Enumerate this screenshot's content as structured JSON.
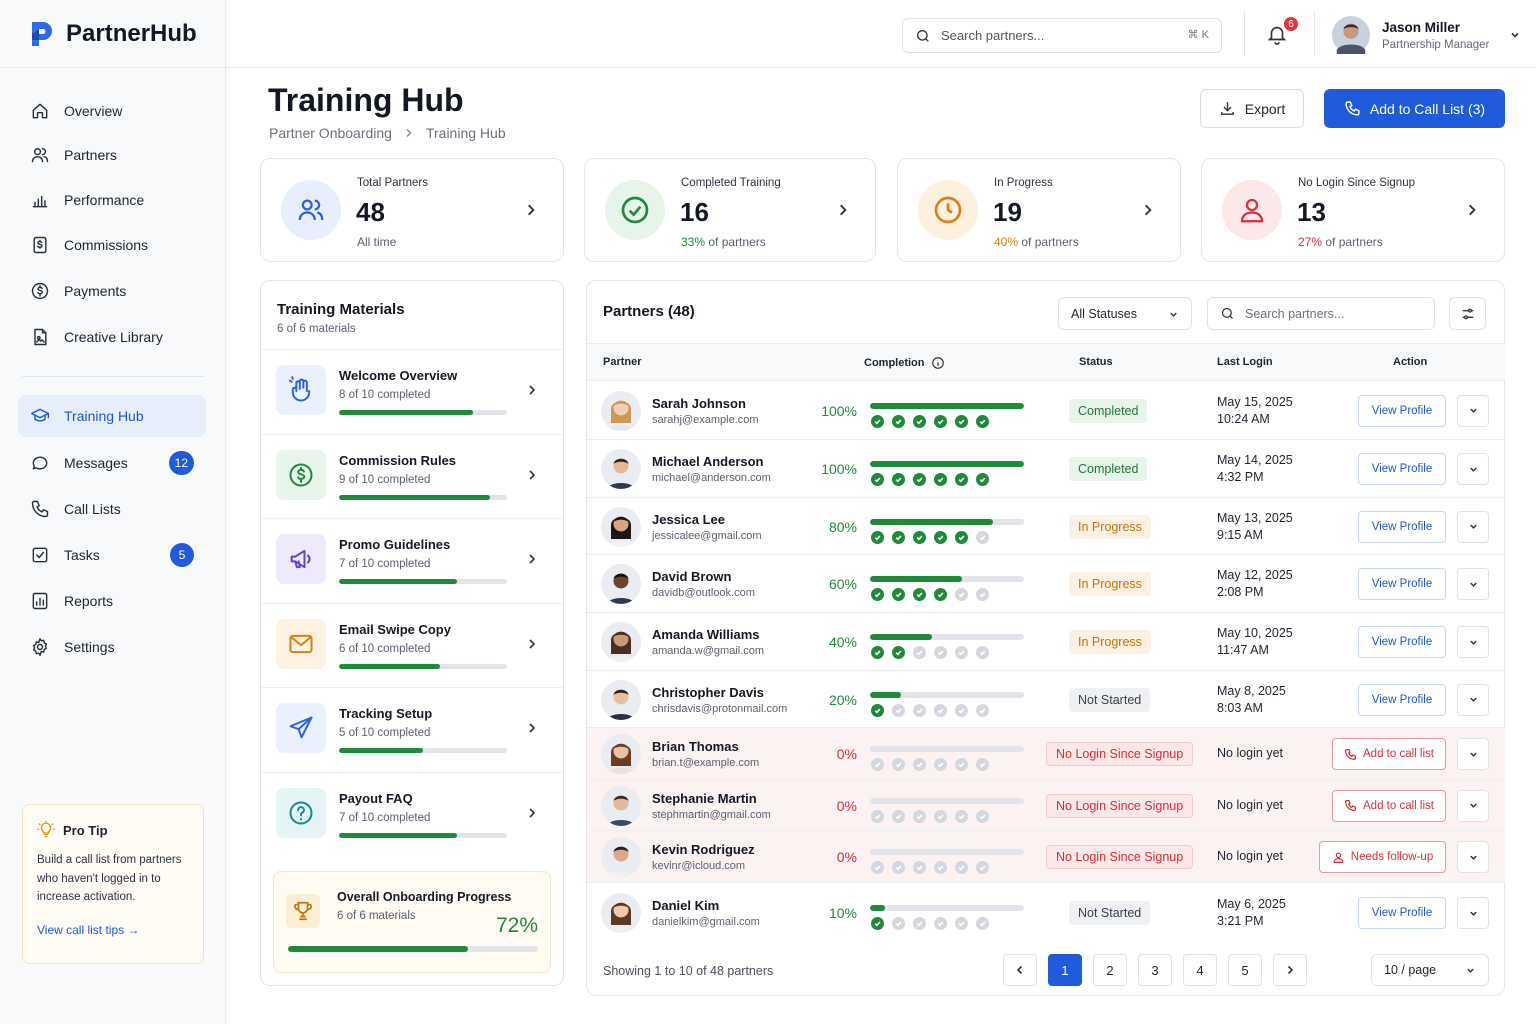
{
  "app": {
    "name": "PartnerHub"
  },
  "sidebar": {
    "items": [
      {
        "label": "Overview",
        "icon": "home-icon"
      },
      {
        "label": "Partners",
        "icon": "users-icon"
      },
      {
        "label": "Performance",
        "icon": "bar-chart-icon"
      },
      {
        "label": "Commissions",
        "icon": "dollar-doc-icon"
      },
      {
        "label": "Payments",
        "icon": "dollar-circle-icon"
      },
      {
        "label": "Creative Library",
        "icon": "image-file-icon"
      },
      {
        "label": "Training Hub",
        "icon": "graduation-cap-icon",
        "active": true
      },
      {
        "label": "Messages",
        "icon": "chat-icon",
        "badge": "12"
      },
      {
        "label": "Call Lists",
        "icon": "phone-icon"
      },
      {
        "label": "Tasks",
        "icon": "checkbox-icon",
        "badge": "5"
      },
      {
        "label": "Reports",
        "icon": "report-icon"
      },
      {
        "label": "Settings",
        "icon": "gear-icon"
      }
    ],
    "protip": {
      "title": "Pro Tip",
      "text": "Build a call list from partners who haven't logged in to increase activation.",
      "link": "View call list tips →"
    }
  },
  "topbar": {
    "search_placeholder": "Search partners...",
    "shortcut": "⌘ K",
    "notifications": "6",
    "user": {
      "name": "Jason Miller",
      "role": "Partnership Manager"
    }
  },
  "page": {
    "title": "Training Hub",
    "breadcrumbs": [
      "Partner Onboarding",
      "Training Hub"
    ],
    "export_label": "Export",
    "call_label": "Add to Call List (3)"
  },
  "stats": [
    {
      "label": "Total Partners",
      "value": "48",
      "pct": "",
      "sub": "All time",
      "color": "#2f63d8"
    },
    {
      "label": "Completed Training",
      "value": "16",
      "pct": "33%",
      "sub": "of partners",
      "color": "#1f8a3c"
    },
    {
      "label": "In Progress",
      "value": "19",
      "pct": "40%",
      "sub": "of partners",
      "color": "#d98112"
    },
    {
      "label": "No Login Since Signup",
      "value": "13",
      "pct": "27%",
      "sub": "of partners",
      "color": "#d3303a"
    }
  ],
  "materials": {
    "title": "Training Materials",
    "subtitle": "6 of 6 materials",
    "items": [
      {
        "name": "Welcome Overview",
        "progress": "8 of 10 completed",
        "fraction": 0.8
      },
      {
        "name": "Commission Rules",
        "progress": "9 of 10 completed",
        "fraction": 0.9
      },
      {
        "name": "Promo Guidelines",
        "progress": "7 of 10 completed",
        "fraction": 0.7
      },
      {
        "name": "Email Swipe Copy",
        "progress": "6 of 10 completed",
        "fraction": 0.6
      },
      {
        "name": "Tracking Setup",
        "progress": "5 of 10 completed",
        "fraction": 0.5
      },
      {
        "name": "Payout FAQ",
        "progress": "7 of 10 completed",
        "fraction": 0.7
      }
    ],
    "overall": {
      "title": "Overall Onboarding Progress",
      "sub": "6 of 6 materials",
      "pct": "72%",
      "fraction": 0.72
    }
  },
  "partners": {
    "title": "Partners (48)",
    "status_filter": "All Statuses",
    "search_placeholder": "Search partners...",
    "columns": [
      "Partner",
      "Completion",
      "Status",
      "Last Login",
      "Action"
    ],
    "rows": [
      {
        "name": "Sarah Johnson",
        "email": "sarahj@example.com",
        "pct": "100%",
        "fraction": 1.0,
        "done": 6,
        "status": "Completed",
        "login1": "May 15, 2025",
        "login2": "10:24 AM",
        "action": "View Profile"
      },
      {
        "name": "Michael Anderson",
        "email": "michael@anderson.com",
        "pct": "100%",
        "fraction": 1.0,
        "done": 6,
        "status": "Completed",
        "login1": "May 14, 2025",
        "login2": "4:32 PM",
        "action": "View Profile"
      },
      {
        "name": "Jessica Lee",
        "email": "jessicalee@gmail.com",
        "pct": "80%",
        "fraction": 0.8,
        "done": 5,
        "status": "In Progress",
        "login1": "May 13, 2025",
        "login2": "9:15 AM",
        "action": "View Profile"
      },
      {
        "name": "David Brown",
        "email": "davidb@outlook.com",
        "pct": "60%",
        "fraction": 0.6,
        "done": 4,
        "status": "In Progress",
        "login1": "May 12, 2025",
        "login2": "2:08 PM",
        "action": "View Profile"
      },
      {
        "name": "Amanda Williams",
        "email": "amanda.w@gmail.com",
        "pct": "40%",
        "fraction": 0.4,
        "done": 2,
        "status": "In Progress",
        "login1": "May 10, 2025",
        "login2": "11:47 AM",
        "action": "View Profile"
      },
      {
        "name": "Christopher Davis",
        "email": "chrisdavis@protonmail.com",
        "pct": "20%",
        "fraction": 0.2,
        "done": 1,
        "status": "Not Started",
        "login1": "May 8, 2025",
        "login2": "8:03 AM",
        "action": "View Profile"
      },
      {
        "name": "Brian Thomas",
        "email": "brian.t@example.com",
        "pct": "0%",
        "fraction": 0,
        "done": 0,
        "status": "No Login Since Signup",
        "login1": "No login yet",
        "login2": "",
        "action": "Add to call list"
      },
      {
        "name": "Stephanie Martin",
        "email": "stephmartin@gmail.com",
        "pct": "0%",
        "fraction": 0,
        "done": 0,
        "status": "No Login Since Signup",
        "login1": "No login yet",
        "login2": "",
        "action": "Add to call list"
      },
      {
        "name": "Kevin Rodriguez",
        "email": "kevinr@icloud.com",
        "pct": "0%",
        "fraction": 0,
        "done": 0,
        "status": "No Login Since Signup",
        "login1": "No login yet",
        "login2": "",
        "action": "Needs follow-up"
      },
      {
        "name": "Daniel Kim",
        "email": "danielkim@gmail.com",
        "pct": "10%",
        "fraction": 0.1,
        "done": 1,
        "status": "Not Started",
        "login1": "May 6, 2025",
        "login2": "3:21 PM",
        "action": "View Profile"
      }
    ],
    "footer": "Showing 1 to 10 of 48 partners",
    "pages": [
      "1",
      "2",
      "3",
      "4",
      "5"
    ],
    "page_size": "10 / page"
  }
}
